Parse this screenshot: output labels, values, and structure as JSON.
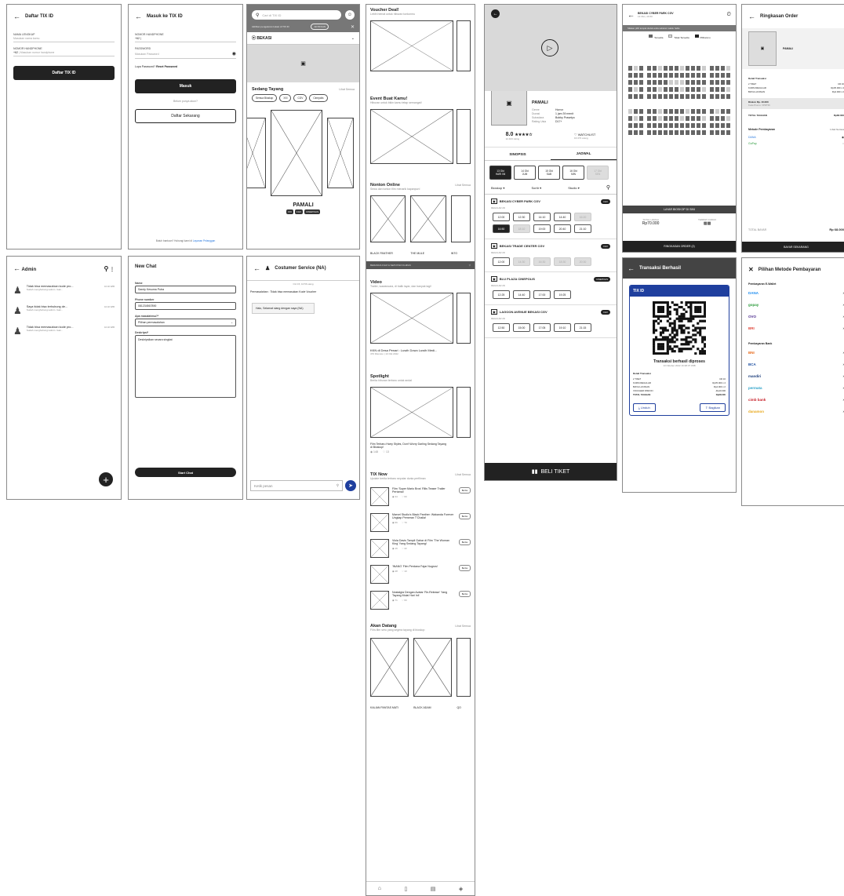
{
  "daftar": {
    "title": "Daftar TIX ID",
    "f1_label": "NAMA LENGKAP",
    "f1_ph": "Masukan nama kamu",
    "f2_label": "NOMOR HANDPHONE",
    "f2_prefix": "+62",
    "f2_ph": "Masukan nomor handphone",
    "button": "Daftar TIX ID"
  },
  "masuk": {
    "title": "Masuk ke TIX ID",
    "f1_label": "NOMOR HANDPHONE",
    "f1_value": "+62 |",
    "f2_label": "PASSWORD",
    "f2_ph": "Masukan Password",
    "forgot": "Lupa Password?",
    "reset": "Reset Password",
    "login": "Masuk",
    "no_account": "Belum punya akun?",
    "register": "Daftar Sekarang",
    "help": "Butuh bantuan? Hubungi kami di",
    "help_link": "Layanan Pelanggan"
  },
  "home": {
    "search_ph": "Cari di TIX ID",
    "notice": "Aktifkan pengaturan lokasi di TIX ID",
    "notice_btn": "AKTIFKAN",
    "city": "BEKASI",
    "section": "Sedang Tayang",
    "see_all": "Lihat Semua",
    "filters": [
      "Semua Bioskop",
      "XXI",
      "CGV",
      "Cinepolis"
    ],
    "movie": "PAMALI",
    "badges": [
      "XXI",
      "CGV",
      "CINEPOLIS"
    ]
  },
  "admin": {
    "title": "Admin",
    "chats": [
      {
        "title": "Tidak bisa memasukkan kode pro...",
        "sub": "Sudah menghubungi admin. Gak...",
        "time": "16.40 WIB"
      },
      {
        "title": "Saya tidak bisa terhubung de...",
        "sub": "Sudah menghubungi admin. Gak...",
        "time": "16.40 WIB"
      },
      {
        "title": "Tidak bisa memasukkan kode pro...",
        "sub": "Sudah menghubungi admin. Gak...",
        "time": "16.40 WIB"
      }
    ]
  },
  "newchat": {
    "title": "New Chat",
    "name_label": "Name",
    "name_value": "Sandy Kesuma Putra",
    "phone_label": "Phone number",
    "phone_value": "081234567890",
    "issue_label": "Apa masalahmu?*",
    "issue_value": "Pilihan permasalahan",
    "desc_label": "Deskripsi*",
    "desc_value": "Deskripsikan secara singkat",
    "button": "Start Chat"
  },
  "cs": {
    "title": "Costumer Service (NA)",
    "date": "Oct 15, 10:56 siang",
    "msg1": "Permasalahan : Tidak bisa memasukan Kode Voucher",
    "msg2": "Halo, Selamat siang dengan saya (NA)",
    "input_ph": "Ketik pesan"
  },
  "feed": {
    "voucher_title": "Voucher Deal!",
    "voucher_sub": "Lebih hemat untuk hiburan tontonmu",
    "event_title": "Event Buat Kamu!",
    "event_sub": "Hiburan untuk bikin kamu tetap semangat!",
    "online_title": "Nonton Online",
    "online_sub": "Sewa dan tonton film menarik kapanpun!",
    "see_all": "Lihat Semua",
    "online_films": [
      "BLACK PANTHER",
      "THE MULE",
      "INTO"
    ],
    "banner": "BERANDA FILM & SEPUTAR FILMMU",
    "video_title": "Video",
    "video_sub": "Trailer, wawancara, di balik layar, dan banyak lagi!",
    "video_caption": "KKN di Desa Penari : Luwih Dowo Luwih Medi...",
    "video_meta": "470 Ditonton | 13 Okt 2022",
    "spot_title": "Spotlight",
    "spot_sub": "Berita hiburan terbaru untuk andal",
    "spot_caption": "Film Terbaru Harry Styles, Don't Worry Darling Sedang Tayang di Bioskop!",
    "spot_views": "148",
    "spot_likes": "13",
    "news_title": "TIX Now",
    "news_sub": "Update berita terbaru seputar dunia perfilman",
    "news": [
      {
        "title": "Film 'Super Mario Bros' Rilis Teaser Trailer Pertama!",
        "views": "34",
        "likes": "63",
        "tag": "Berita"
      },
      {
        "title": "Marvel Studio's Black Panther: Wakanda Forever Ungkap Pemeran T'Challa!",
        "views": "66",
        "likes": "73",
        "tag": "Berita"
      },
      {
        "title": "Viola Davis Tampil Gahar di Film 'The Woman King' Yang Sedang Tayang!",
        "views": "16",
        "likes": "22",
        "tag": "Berita"
      },
      {
        "title": "'INANG' Film Perdana Fajar Nugros!",
        "views": "28",
        "likes": "13",
        "tag": "Berita"
      },
      {
        "title": "Nostalgia Dengan Avatar 'Re-Release' Yang Tayang Mulai Hari Ini!",
        "views": "71",
        "likes": "63",
        "tag": "Berita"
      }
    ],
    "soon_title": "Akan Datang",
    "soon_sub": "Film-film seru yang segera tayang di bioskop",
    "soon_films": [
      "KALIAN PANTAS MATI",
      "BLACK ADAM",
      "QO"
    ]
  },
  "movie": {
    "title": "PAMALI",
    "rows": [
      [
        "Genre",
        "Horror"
      ],
      [
        "Durasi",
        "1 jam 39 menit"
      ],
      [
        "Sutradara",
        "Bobby Prasetyo"
      ],
      [
        "Rating Usia",
        "D17+"
      ]
    ],
    "rating": "8.0",
    "rating_sub": "12.403 rating",
    "watch": "WATCHLIST",
    "watch_sub": "16.373 orang",
    "tab1": "SINOPSIS",
    "tab2": "JADWAL",
    "dates": [
      [
        "13 Okt",
        "HARI INI"
      ],
      [
        "14 Okt",
        "JUM"
      ],
      [
        "15 Okt",
        "SAB"
      ],
      [
        "16 Okt",
        "MIN"
      ],
      [
        "17 Okt",
        "SEN"
      ]
    ],
    "f1": "Bioskop",
    "f2": "Sortir",
    "f3": "Studio",
    "cinemas": [
      {
        "name": "BEKASI CYBER PARK CGV",
        "badge": "CGV",
        "times": [
          "12:00",
          "12:30",
          "14:10",
          "14:40",
          "16:20",
          "16:50",
          "18:10",
          "19:00",
          "20:40",
          "21:10"
        ]
      },
      {
        "name": "BEKASI TRADE CENTER CGV",
        "badge": "CGV",
        "times": [
          "12:00",
          "14:30",
          "16:30",
          "18:30",
          "20:30"
        ]
      },
      {
        "name": "BLU PLAZA CINEPOLIS",
        "badge": "CINEPOLIS",
        "times": [
          "12:25",
          "14:40",
          "17:00",
          "19:25"
        ]
      },
      {
        "name": "LAGOON AVENUE BEKASI CGV",
        "badge": "CGV",
        "times": [
          "12:50",
          "15:00",
          "17:05",
          "19:10",
          "21:15"
        ]
      }
    ],
    "regular": "REGULAR 2D",
    "buy": "BELI TIKET"
  },
  "seat": {
    "title": "BEKASI CYBER PARK CGV",
    "sub": "13 Okt | 16.50",
    "info": "Silakan pilih tempat duduk anda sebelum waktu habis",
    "legend": [
      "Tersedia",
      "Tidak Tersedia",
      "Pilihanmu"
    ],
    "screen": "LAYAR BIOSKOP DI SINI",
    "total_label": "TOTAL HARGA",
    "total": "Rp70.000",
    "seat_label": "TEMPAT DUDUK",
    "btn": "RINGKASAN ORDER (2)"
  },
  "success": {
    "title": "Transaksi Berhasil",
    "brand": "TIX ID",
    "msg": "Transaksi berhasil diproses",
    "date": "13 Oktober 2022 16:38:37 WIB",
    "detail": "Detail Transaksi",
    "rows": [
      [
        "2 TIKET",
        "CR 16"
      ],
      [
        "KURSI REGULAR",
        "Rp35.000 x 2"
      ],
      [
        "BIAYA LAYANAN",
        "Rp4.000 x 2"
      ],
      [
        "VOUCHER DISKON",
        "-Rp10.000"
      ],
      [
        "TOTAL TAGIHAN",
        "Rp68.000"
      ]
    ],
    "btn1": "Unduh",
    "btn2": "Bagikan"
  },
  "order": {
    "title": "Ringkasan Order",
    "film": "PAMALI",
    "rows": [
      [
        "2 TIKET",
        "CR 16"
      ],
      [
        "KURSI REGULAR",
        "Rp35.000 x 2"
      ],
      [
        "BIAYA LAYANAN",
        "Rp4.000 x 2"
      ]
    ],
    "detail": "Detail Transaksi",
    "voucher": "Diskon Rp. 10.000",
    "voucher_code": "Kode Promo: VPDT36",
    "total_label": "TOTAL TAGIHAN",
    "total": "Rp68.000",
    "method_label": "Metode Pembayaran",
    "see_all": "Lihat Semua",
    "methods": [
      "DANA",
      "GoPay"
    ],
    "pay_label": "TOTAL BAYAR",
    "pay_total": "Rp 68.000",
    "btn": "BAYAR SEKARANG"
  },
  "paymethod": {
    "title": "Pilihan Metode Pembayaran",
    "ewallet": "Pembayaran E-Wallet",
    "ew": [
      "DANA",
      "gopay",
      "OVO",
      "BRI"
    ],
    "bank": "Pembayaran Bank",
    "banks": [
      "BNI",
      "BCA",
      "mandiri",
      "permata",
      "cimb bank",
      "danamon"
    ]
  }
}
